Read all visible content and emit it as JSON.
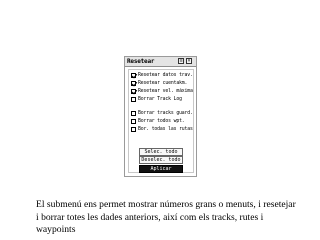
{
  "window": {
    "title": "Resetear",
    "menu_icon": "menu-icon",
    "close_icon": "close-icon"
  },
  "options": [
    {
      "label": "Resetear datos trav.",
      "checked": true
    },
    {
      "label": "Resetear cuentakm.",
      "checked": true
    },
    {
      "label": "Resetear vel. máxima",
      "checked": true
    },
    {
      "label": "Borrar Track Log",
      "checked": false
    },
    {
      "label": "Borrar tracks guard.",
      "checked": false
    },
    {
      "label": "Borrar todos wpt.",
      "checked": false
    },
    {
      "label": "Bor. todas las rutas",
      "checked": false
    }
  ],
  "buttons": {
    "select_all": "Selec. todo",
    "deselect_all": "Deselec. todo",
    "apply": "Aplicar"
  },
  "caption": "El submenú ens permet mostrar números grans o menuts, i resetejar i borrar totes les dades anteriors, així com els tracks, rutes i waypoints"
}
